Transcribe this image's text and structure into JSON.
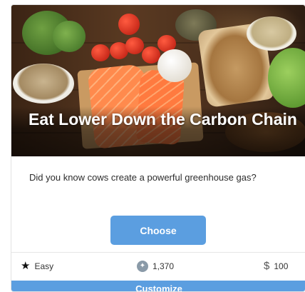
{
  "card": {
    "title": "Eat Lower Down the Carbon Chain",
    "description": "Did you know cows create a powerful greenhouse gas?",
    "choose_label": "Choose",
    "customize_label": "Customize",
    "meta": {
      "difficulty": "Easy",
      "points": "1,370",
      "cost": "100"
    }
  },
  "icons": {
    "difficulty": "star-icon",
    "points": "badge-icon",
    "cost": "dollar-icon"
  },
  "colors": {
    "button": "#5b9ee0",
    "title_text": "#ffffff"
  }
}
